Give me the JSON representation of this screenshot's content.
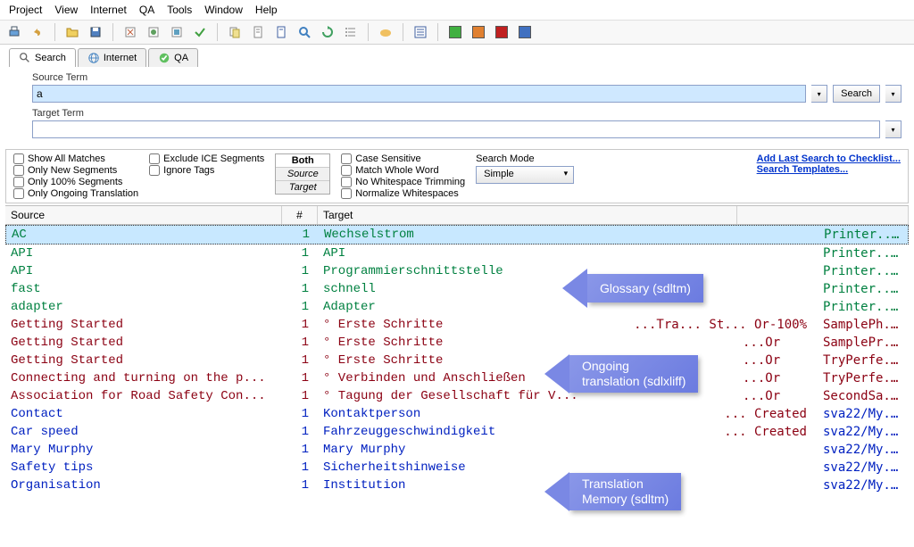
{
  "menu": [
    "Project",
    "View",
    "Internet",
    "QA",
    "Tools",
    "Window",
    "Help"
  ],
  "tabs": [
    {
      "label": "Search",
      "active": true,
      "icon": "search-icon"
    },
    {
      "label": "Internet",
      "active": false,
      "icon": "globe-icon"
    },
    {
      "label": "QA",
      "active": false,
      "icon": "check-icon"
    }
  ],
  "source_term_label": "Source Term",
  "source_term_value": "a",
  "target_term_label": "Target Term",
  "target_term_value": "",
  "search_button": "Search",
  "options": {
    "col1": [
      "Show All Matches",
      "Only New Segments",
      "Only 100% Segments",
      "Only Ongoing Translation"
    ],
    "col2": [
      "Exclude ICE Segments",
      "Ignore Tags"
    ],
    "toggles": [
      "Both",
      "Source",
      "Target"
    ],
    "toggle_active": 0,
    "col3": [
      "Case Sensitive",
      "Match Whole Word",
      "No Whitespace Trimming",
      "Normalize Whitespaces"
    ],
    "mode_label": "Search Mode",
    "mode_value": "Simple",
    "links": [
      "Add Last Search to Checklist...",
      "Search Templates..."
    ]
  },
  "headers": {
    "source": "Source",
    "num": "#",
    "target": "Target"
  },
  "rows": [
    {
      "src": "AC",
      "n": "1",
      "tgt": "Wechselstrom",
      "extra": "",
      "file": "Printer....",
      "cls": "c-green",
      "sel": true
    },
    {
      "src": "API",
      "n": "1",
      "tgt": "API",
      "extra": "",
      "file": "Printer....",
      "cls": "c-green"
    },
    {
      "src": "API",
      "n": "1",
      "tgt": "Programmierschnittstelle",
      "extra": "",
      "file": "Printer....",
      "cls": "c-green"
    },
    {
      "src": "fast",
      "n": "1",
      "tgt": "schnell",
      "extra": "",
      "file": "Printer....",
      "cls": "c-green"
    },
    {
      "src": "adapter",
      "n": "1",
      "tgt": "Adapter",
      "extra": "",
      "file": "Printer....",
      "cls": "c-green"
    },
    {
      "src": "Getting Started",
      "n": "1",
      "tgt": "° Erste Schritte",
      "extra": "100%-Tra... St... Or...",
      "file": "SamplePh...",
      "cls": "c-brown"
    },
    {
      "src": "Getting Started",
      "n": "1",
      "tgt": "° Erste Schritte",
      "extra": "Or...",
      "file": "SamplePr...",
      "cls": "c-brown"
    },
    {
      "src": "Getting Started",
      "n": "1",
      "tgt": "° Erste Schritte",
      "extra": "Or...",
      "file": "TryPerfe...",
      "cls": "c-brown"
    },
    {
      "src": "Connecting and turning on the p...",
      "n": "1",
      "tgt": "° Verbinden und Anschließen",
      "extra": "Or...",
      "file": "TryPerfe...",
      "cls": "c-brown"
    },
    {
      "src": "Association for Road Safety Con...",
      "n": "1",
      "tgt": "° Tagung der Gesellschaft für V...",
      "extra": "Or...",
      "file": "SecondSa...",
      "cls": "c-brown"
    },
    {
      "src": "Contact",
      "n": "1",
      "tgt": "Kontaktperson",
      "extra": "Created ...",
      "file": "sva22/My...",
      "cls": "c-blue"
    },
    {
      "src": "Car speed",
      "n": "1",
      "tgt": "Fahrzeuggeschwindigkeit",
      "extra": "Created ...",
      "file": "sva22/My...",
      "cls": "c-blue"
    },
    {
      "src": "Mary Murphy",
      "n": "1",
      "tgt": "Mary Murphy",
      "extra": "",
      "file": "sva22/My...",
      "cls": "c-blue"
    },
    {
      "src": "Safety tips",
      "n": "1",
      "tgt": "Sicherheitshinweise",
      "extra": "",
      "file": "sva22/My...",
      "cls": "c-blue"
    },
    {
      "src": "Organisation",
      "n": "1",
      "tgt": "Institution",
      "extra": "",
      "file": "sva22/My...",
      "cls": "c-blue"
    }
  ],
  "callouts": {
    "glossary": "Glossary (sdltm)",
    "ongoing": "Ongoing translation (sdlxliff)",
    "tm": "Translation Memory (sdltm)"
  }
}
